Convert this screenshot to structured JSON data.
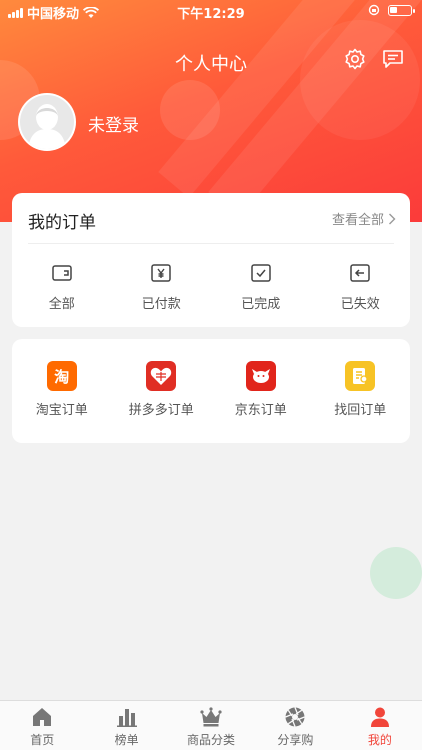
{
  "status_bar": {
    "carrier": "中国移动",
    "time": "下午12:29"
  },
  "header": {
    "title": "个人中心",
    "login_text": "未登录"
  },
  "orders": {
    "title": "我的订单",
    "view_all": "查看全部",
    "items": [
      {
        "label": "全部",
        "icon": "wallet-icon"
      },
      {
        "label": "已付款",
        "icon": "yen-icon"
      },
      {
        "label": "已完成",
        "icon": "check-box-icon"
      },
      {
        "label": "已失效",
        "icon": "return-icon"
      }
    ]
  },
  "platforms": {
    "items": [
      {
        "label": "淘宝订单",
        "icon": "taobao-icon",
        "glyph": "淘",
        "color": "#ff6a00"
      },
      {
        "label": "拼多多订单",
        "icon": "pinduoduo-icon",
        "color": "#e02e24"
      },
      {
        "label": "京东订单",
        "icon": "jd-icon",
        "color": "#e1251b"
      },
      {
        "label": "找回订单",
        "icon": "find-order-icon",
        "color": "#f7c325"
      }
    ]
  },
  "tabbar": {
    "items": [
      {
        "label": "首页",
        "icon": "home-icon"
      },
      {
        "label": "榜单",
        "icon": "bar-chart-icon"
      },
      {
        "label": "商品分类",
        "icon": "crown-icon"
      },
      {
        "label": "分享购",
        "icon": "aperture-icon"
      },
      {
        "label": "我的",
        "icon": "person-icon",
        "active": true
      }
    ]
  },
  "colors": {
    "accent": "#f1453a",
    "header_start": "#ff8a3d",
    "header_end": "#fb3b3a"
  }
}
